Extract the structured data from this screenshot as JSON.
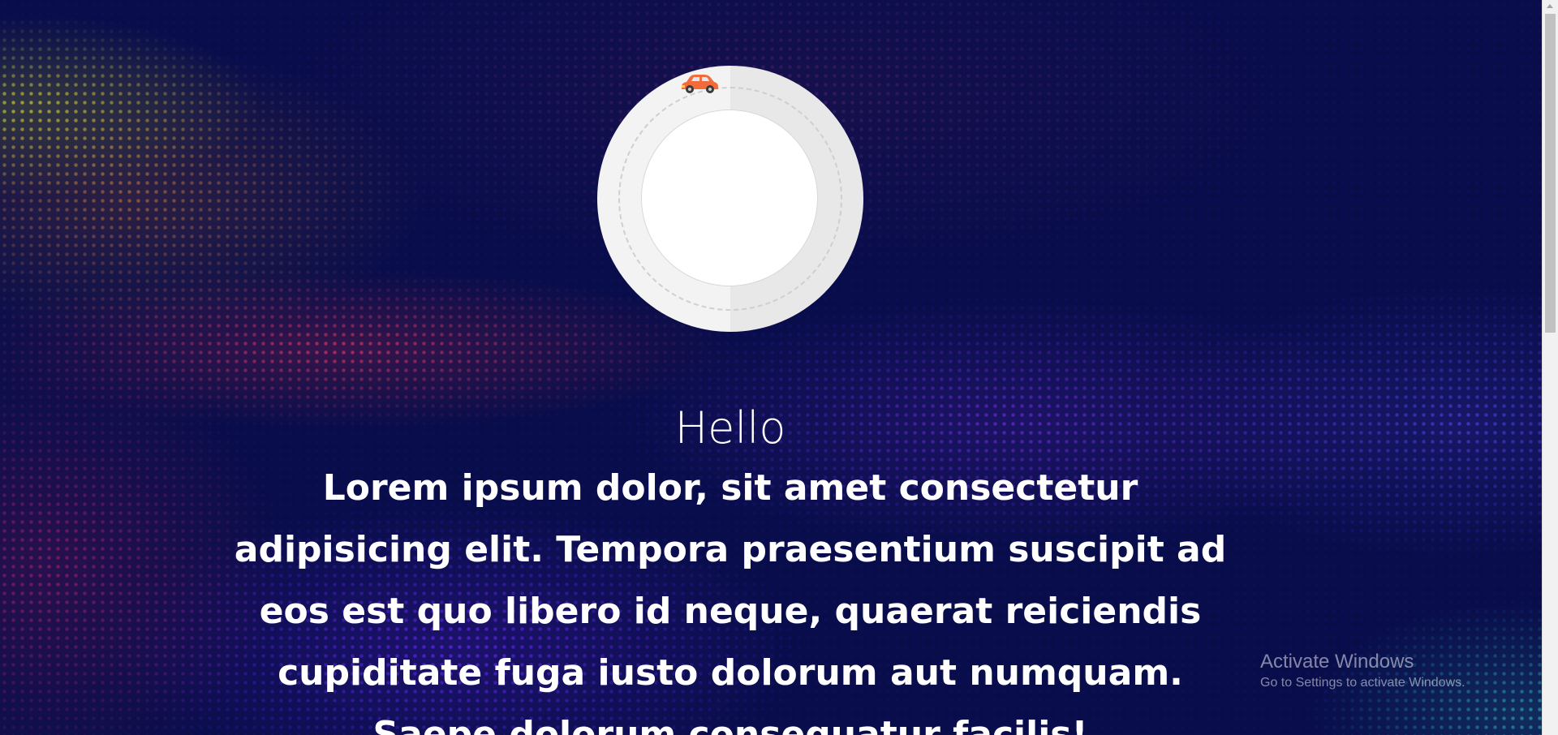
{
  "hero": {
    "greeting": "Hello",
    "paragraph": "Lorem ipsum dolor, sit amet consectetur adipisicing elit. Tempora praesentium suscipit ad eos est quo libero id neque, quaerat reiciendis cupiditate fuga iusto dolorum aut numquam. Saepe dolorum consequatur facilis!"
  },
  "loader": {
    "icon": "car-icon",
    "car_color": "#f26b3a"
  },
  "watermark": {
    "title": "Activate Windows",
    "subtitle": "Go to Settings to activate Windows."
  },
  "colors": {
    "background": "#0a0f55",
    "text": "#ffffff"
  }
}
